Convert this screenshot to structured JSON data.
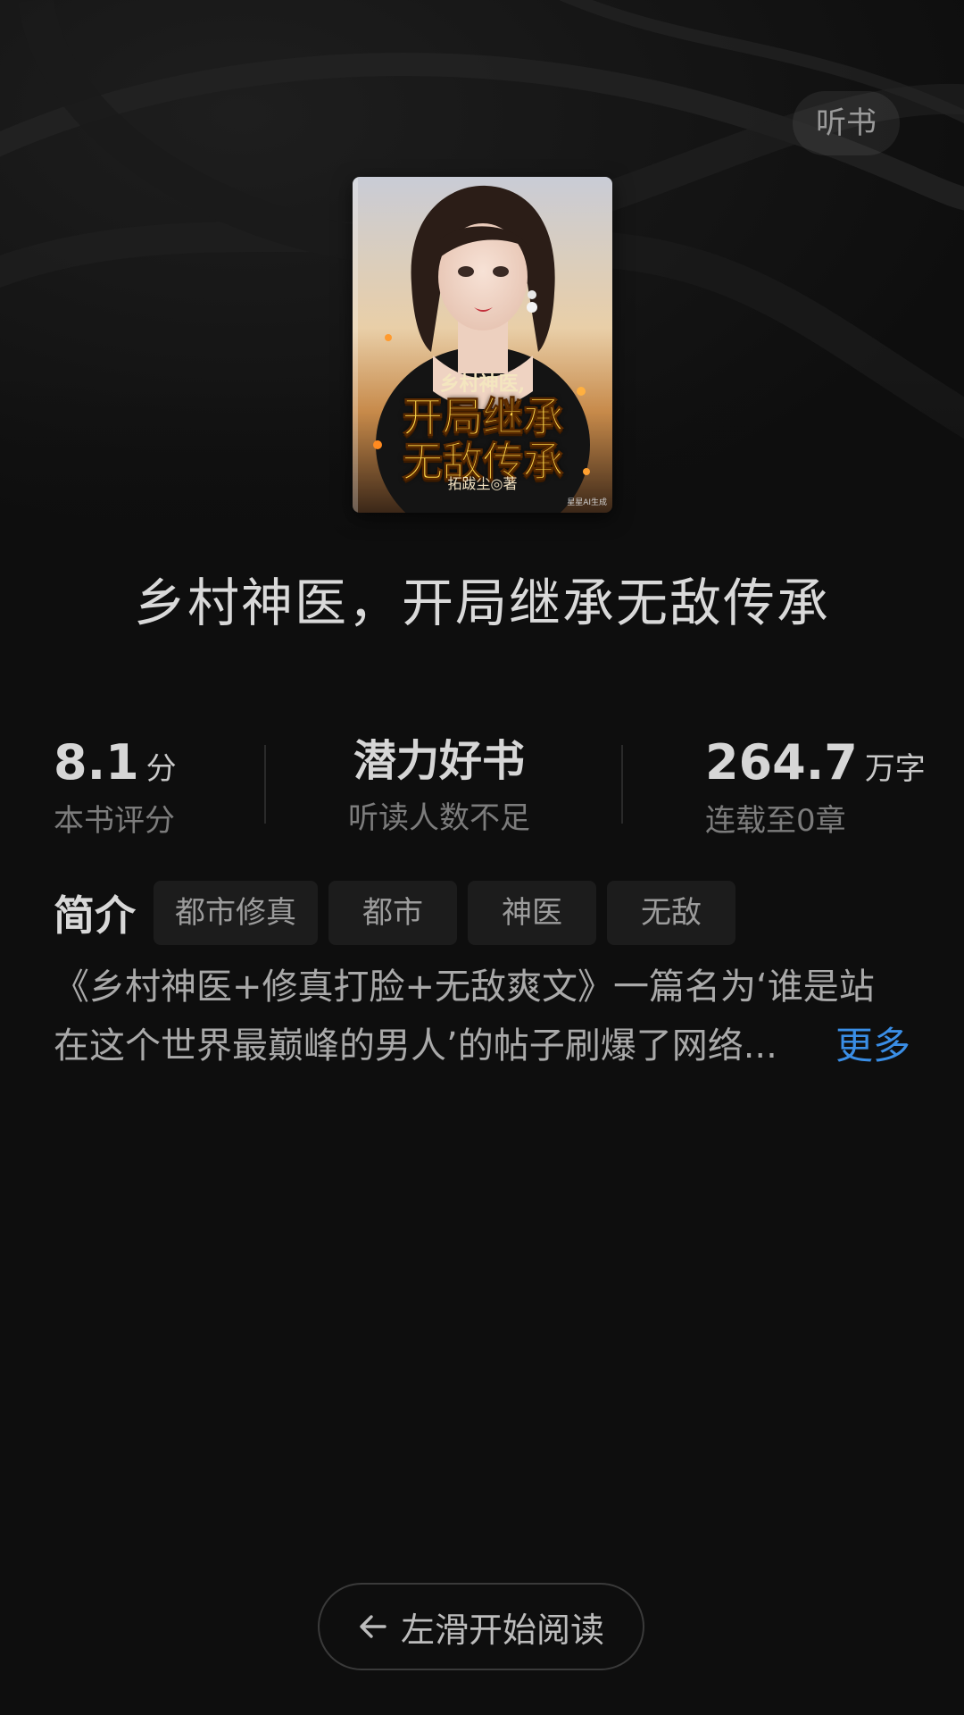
{
  "header": {
    "listen_label": "听书"
  },
  "cover": {
    "small_title": "乡村神医,",
    "big_title_line1": "开局继承",
    "big_title_line2": "无敌传承",
    "author": "拓跋尘◎著",
    "mark": "星星AI生成"
  },
  "book": {
    "title": "乡村神医，开局继承无敌传承"
  },
  "stats": {
    "rating_value": "8.1",
    "rating_unit": "分",
    "rating_label": "本书评分",
    "potential_title": "潜力好书",
    "potential_label": "听读人数不足",
    "words_value": "264.7",
    "words_unit": "万字",
    "words_label": "连载至0章"
  },
  "intro": {
    "label": "简介",
    "tags": [
      "都市修真",
      "都市",
      "神医",
      "无敌"
    ],
    "line1": "《乡村神医+修真打脸+无敌爽文》一篇名为‘谁是站",
    "line2": "在这个世界最巅峰的男人’的帖子刷爆了网络...",
    "more_label": "更多"
  },
  "footer": {
    "swipe_label": "左滑开始阅读"
  },
  "colors": {
    "background": "#0e0e0e",
    "accent_link": "#3a8ee6",
    "title_text": "#d9d9d9",
    "muted_text": "#7c7c7c"
  }
}
